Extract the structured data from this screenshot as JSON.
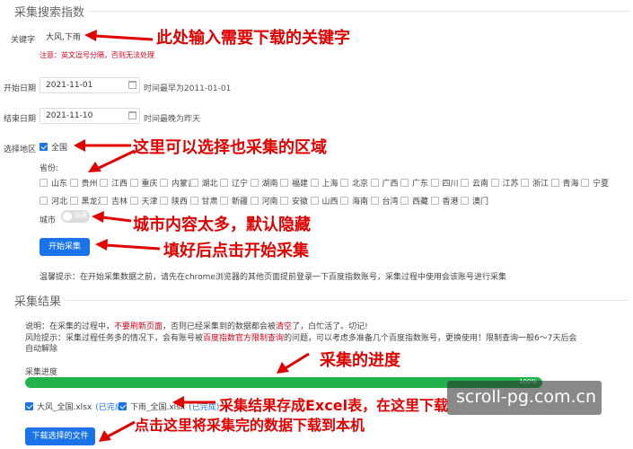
{
  "search": {
    "title": "采集搜索指数",
    "keyword_label": "关键字",
    "keyword_value": "大风,下雨",
    "keyword_note": "注意：英文逗号分隔，否则无法处理",
    "start_label": "开始日期",
    "start_value": "2021-11-01",
    "start_hint": "时间最早为2011-01-01",
    "end_label": "结束日期",
    "end_value": "2021-11-10",
    "end_hint": "时间最晚为昨天",
    "region_label": "选择地区",
    "nation_label": "全国",
    "province_label": "省份:",
    "provinces_row1": [
      "山东",
      "贵州",
      "江西",
      "重庆",
      "内蒙古",
      "湖北",
      "辽宁",
      "湖南",
      "福建",
      "上海",
      "北京",
      "广西",
      "广东",
      "四川",
      "云南",
      "江苏",
      "浙江",
      "青海",
      "宁夏"
    ],
    "provinces_row2": [
      "河北",
      "黑龙江",
      "吉林",
      "天津",
      "陕西",
      "甘肃",
      "新疆",
      "河南",
      "安徽",
      "山西",
      "海南",
      "台湾",
      "西藏",
      "香港",
      "澳门"
    ],
    "city_label": "城市",
    "city_toggle_text": "隐藏",
    "start_button": "开始采集",
    "tip": "温馨提示：在开始采集数据之前，请先在chrome浏览器的其他页面提前登录一下百度指数账号，采集过程中使用会该账号进行采集"
  },
  "results": {
    "title": "采集结果",
    "desc_prefix": "说明：在采集的过程中，",
    "desc_red1": "不要刷新页面",
    "desc_mid": "，否则已经采集到的数据都会被",
    "desc_red2": "清空",
    "desc_suffix": "了，白忙活了。切记!",
    "risk_prefix": "风险提示：采集过程任务多的情况下，会有账号被",
    "risk_red": "百度指数官方限制查询",
    "risk_suffix": "的问题，可以考虑多准备几个百度指数账号，更换使用！限制查询一般6～7天后会",
    "risk_line2": "自动解除",
    "progress_label": "采集进度",
    "progress_value": 1.0,
    "progress_text": "100%",
    "file1": "大风_全国.xlsx",
    "file1_status": "(已完成)",
    "file2": "下雨_全国.xlsx",
    "file2_status": "(已完成)",
    "download_button": "下载选择的文件"
  },
  "annotations": {
    "a1": "此处输入需要下载的关键字",
    "a2": "这里可以选择也采集的区域",
    "a3": "城市内容太多，默认隐藏",
    "a4": "填好后点击开始采集",
    "a5": "采集的进度",
    "a6": "采集结果存成Excel表，在这里下载",
    "a7": "点击这里将采集完的数据下载到本机"
  },
  "watermark": "scroll-pg.com.cn",
  "colors": {
    "accent": "#1a73e8",
    "progress": "#21b24b",
    "annotation": "#e00000"
  }
}
